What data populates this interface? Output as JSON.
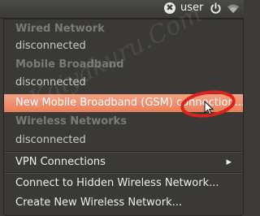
{
  "top_panel": {
    "user_icon_glyph": "✖",
    "user_name": "user"
  },
  "menu": {
    "wired_header": "Wired Network",
    "wired_status": "disconnected",
    "mobile_header": "Mobile Broadband",
    "mobile_status": "disconnected",
    "new_mobile_item": "New Mobile Broadband (GSM) connection...",
    "wireless_header": "Wireless Networks",
    "wireless_status": "disconnected",
    "vpn_item": "VPN Connections",
    "vpn_arrow": "▸",
    "hidden_wireless_item": "Connect to Hidden Wireless Network...",
    "create_wireless_item": "Create New Wireless Network..."
  },
  "watermark": "Kaiyakuru.Com",
  "colors": {
    "highlight": "#e97f5a",
    "annotation_ring": "#d9241d"
  }
}
